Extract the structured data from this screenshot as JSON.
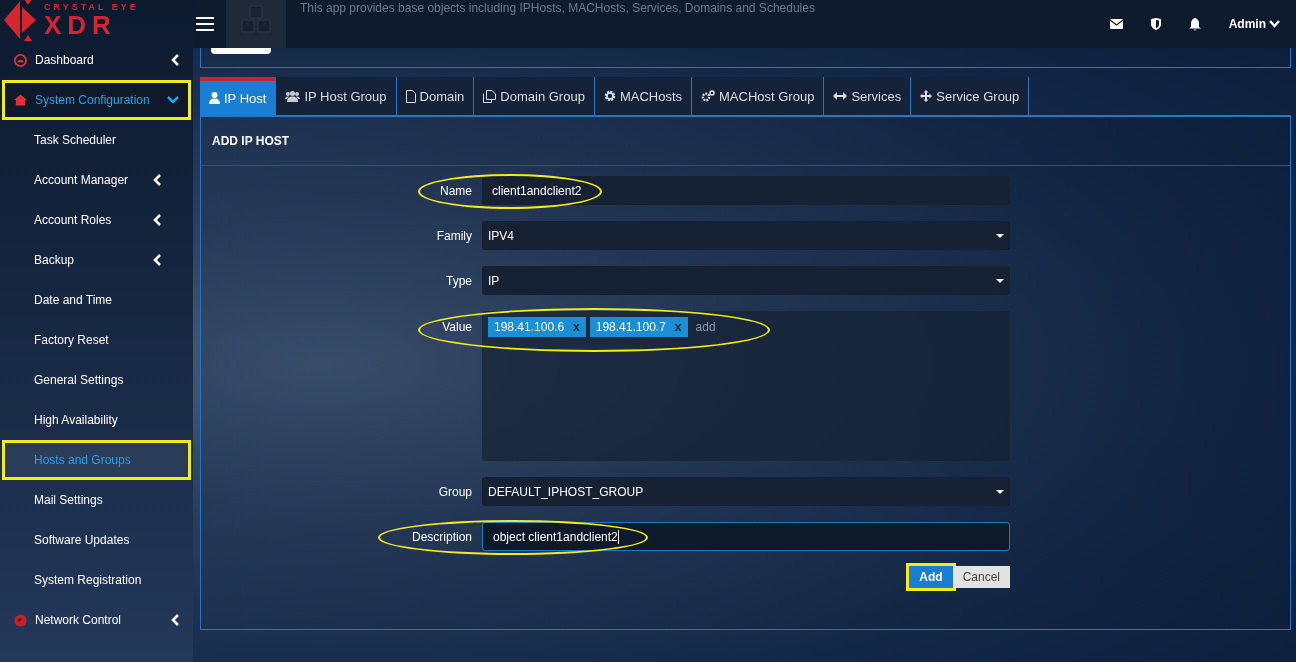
{
  "header": {
    "brand_top": "CRYSTAL EYE",
    "brand_main": "XDR",
    "description": "This app provides base objects including IPHosts, MACHosts, Services, Domains and Schedules",
    "user": "Admin"
  },
  "sidebar": {
    "items": [
      {
        "label": "Dashboard",
        "has_submenu": true,
        "expanded": false,
        "selected": false,
        "highlighted": false
      },
      {
        "label": "System Configuration",
        "has_submenu": true,
        "expanded": true,
        "selected": true,
        "highlighted": true,
        "children": [
          {
            "label": "Task Scheduler",
            "has_submenu": false,
            "selected": false,
            "highlighted": false
          },
          {
            "label": "Account Manager",
            "has_submenu": true,
            "selected": false,
            "highlighted": false
          },
          {
            "label": "Account Roles",
            "has_submenu": true,
            "selected": false,
            "highlighted": false
          },
          {
            "label": "Backup",
            "has_submenu": true,
            "selected": false,
            "highlighted": false
          },
          {
            "label": "Date and Time",
            "has_submenu": false,
            "selected": false,
            "highlighted": false
          },
          {
            "label": "Factory Reset",
            "has_submenu": false,
            "selected": false,
            "highlighted": false
          },
          {
            "label": "General Settings",
            "has_submenu": false,
            "selected": false,
            "highlighted": false
          },
          {
            "label": "High Availability",
            "has_submenu": false,
            "selected": false,
            "highlighted": false
          },
          {
            "label": "Hosts and Groups",
            "has_submenu": false,
            "selected": true,
            "highlighted": true
          },
          {
            "label": "Mail Settings",
            "has_submenu": false,
            "selected": false,
            "highlighted": false
          },
          {
            "label": "Software Updates",
            "has_submenu": false,
            "selected": false,
            "highlighted": false
          },
          {
            "label": "System Registration",
            "has_submenu": false,
            "selected": false,
            "highlighted": false
          }
        ]
      },
      {
        "label": "Network Control",
        "has_submenu": true,
        "expanded": false,
        "selected": false,
        "highlighted": false
      }
    ]
  },
  "tabs": [
    {
      "label": "IP Host",
      "selected": true
    },
    {
      "label": "IP Host Group",
      "selected": false
    },
    {
      "label": "Domain",
      "selected": false
    },
    {
      "label": "Domain Group",
      "selected": false
    },
    {
      "label": "MACHosts",
      "selected": false
    },
    {
      "label": "MACHost Group",
      "selected": false
    },
    {
      "label": "Services",
      "selected": false
    },
    {
      "label": "Service Group",
      "selected": false
    }
  ],
  "form": {
    "title": "ADD IP HOST",
    "fields": [
      {
        "label": "Name",
        "kind": "text",
        "value": "client1andclient2",
        "focused": false,
        "highlighted": true
      },
      {
        "label": "Family",
        "kind": "select",
        "value": "IPV4",
        "highlighted": false
      },
      {
        "label": "Type",
        "kind": "select",
        "value": "IP",
        "highlighted": false
      },
      {
        "label": "Value",
        "kind": "tags",
        "tags": [
          {
            "text": "198.41.100.6",
            "remove": "x"
          },
          {
            "text": "198.41.100.7",
            "remove": "x"
          }
        ],
        "placeholder": "add",
        "highlighted": true
      },
      {
        "label": "Group",
        "kind": "select",
        "value": "DEFAULT_IPHOST_GROUP",
        "highlighted": false
      },
      {
        "label": "Description",
        "kind": "text",
        "value": "object client1andclient2",
        "focused": true,
        "highlighted": true
      }
    ],
    "buttons": [
      {
        "label": "Add",
        "kind": "primary",
        "highlighted": true
      },
      {
        "label": "Cancel",
        "kind": "secondary",
        "highlighted": false
      }
    ]
  }
}
